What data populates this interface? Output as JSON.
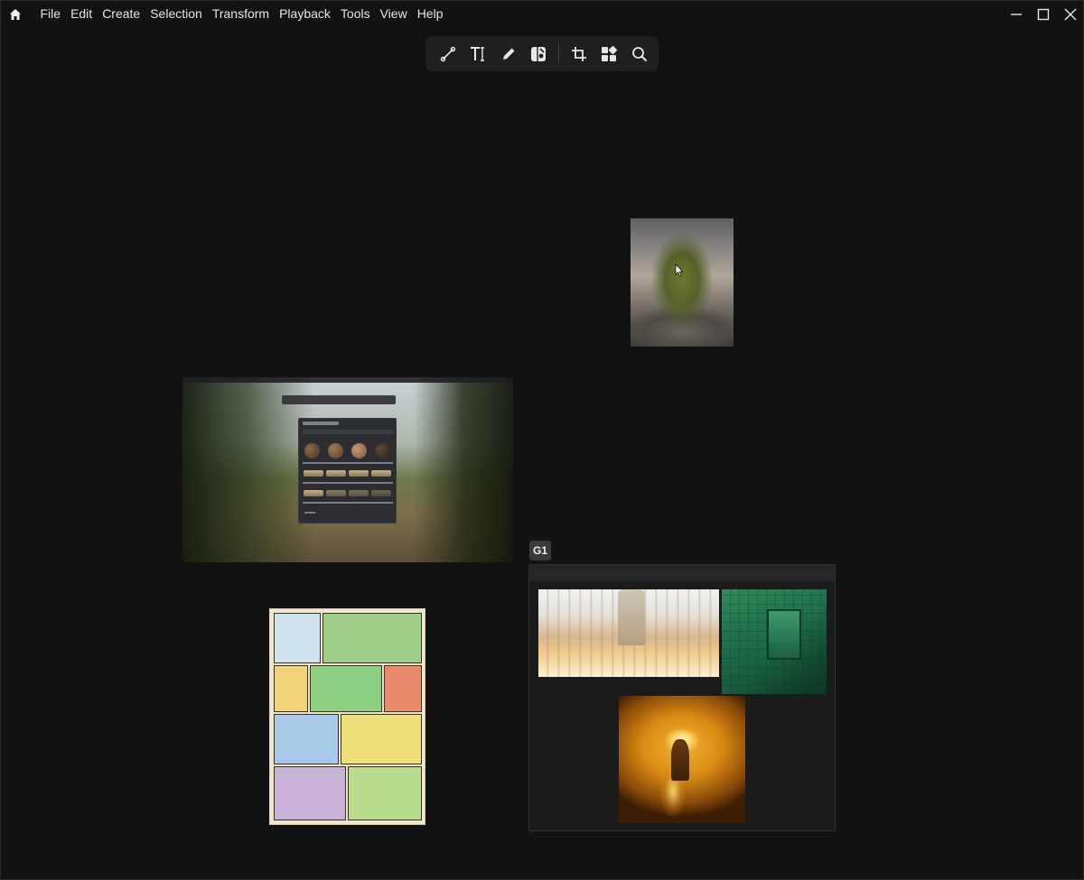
{
  "menubar": {
    "items": [
      "File",
      "Edit",
      "Create",
      "Selection",
      "Transform",
      "Playback",
      "Tools",
      "View",
      "Help"
    ]
  },
  "toolbar": {
    "tools": [
      {
        "name": "line-tool",
        "icon": "line-icon"
      },
      {
        "name": "text-tool",
        "icon": "text-icon"
      },
      {
        "name": "pen-tool",
        "icon": "pencil-icon"
      },
      {
        "name": "color-tool",
        "icon": "color-picker-icon"
      },
      {
        "name": "crop-tool",
        "icon": "crop-icon"
      },
      {
        "name": "arrange-tool",
        "icon": "grid-icon"
      },
      {
        "name": "search-tool",
        "icon": "search-icon"
      }
    ]
  },
  "canvas": {
    "group": {
      "label": "G1"
    }
  },
  "colors": {
    "background": "#121212",
    "toolbar": "#1f1f1f",
    "group_label_bg": "#3a3a3a",
    "text": "#e6e6e6"
  }
}
